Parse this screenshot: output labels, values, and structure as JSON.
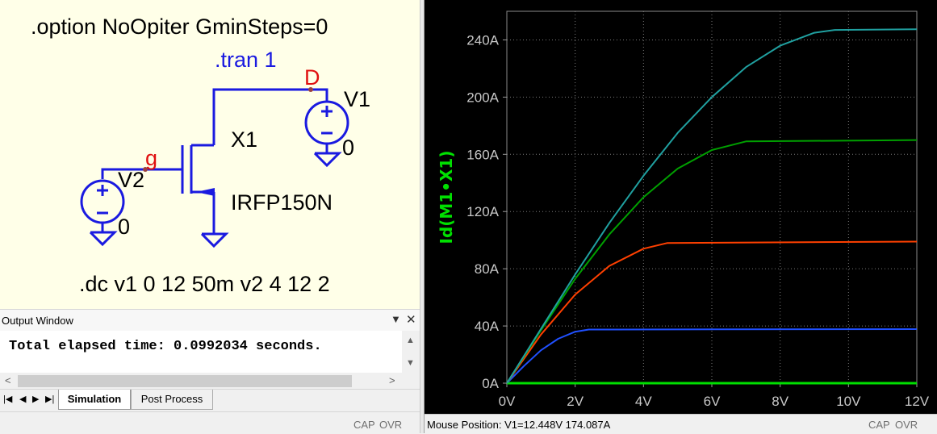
{
  "schematic": {
    "option_directive": ".option NoOpiter GminSteps=0",
    "tran_directive": ".tran 1",
    "dc_directive": ".dc v1 0 12 50m v2 4 12 2",
    "net_drain": "D",
    "net_gate": "g",
    "v1_name": "V1",
    "v1_value": "0",
    "v2_name": "V2",
    "v2_value": "0",
    "mosfet_name": "X1",
    "mosfet_model": "IRFP150N"
  },
  "output_window": {
    "title": "Output Window",
    "message": "Total elapsed time: 0.0992034 seconds.",
    "tabs": [
      "Simulation",
      "Post Process"
    ],
    "status": [
      "CAP",
      "OVR"
    ]
  },
  "plot": {
    "status_text": "Mouse Position: V1=12.448V  174.087A",
    "status": [
      "CAP",
      "OVR"
    ]
  },
  "chart_data": {
    "type": "line",
    "ylabel": "Id(M1•X1)",
    "xlabel": "",
    "xlim": [
      0,
      12
    ],
    "ylim": [
      0,
      260
    ],
    "x_ticks": [
      "0V",
      "2V",
      "4V",
      "6V",
      "8V",
      "10V",
      "12V"
    ],
    "y_ticks": [
      "0A",
      "40A",
      "80A",
      "120A",
      "160A",
      "200A",
      "240A"
    ],
    "grid": true,
    "series": [
      {
        "color": "#00e000",
        "points": [
          [
            0,
            0
          ],
          [
            12,
            0
          ]
        ]
      },
      {
        "color": "#2050ff",
        "points": [
          [
            0,
            0
          ],
          [
            0.5,
            12
          ],
          [
            1,
            23
          ],
          [
            1.5,
            31
          ],
          [
            2,
            36
          ],
          [
            2.4,
            37.5
          ],
          [
            12,
            37.8
          ]
        ]
      },
      {
        "color": "#ff4000",
        "points": [
          [
            0,
            0
          ],
          [
            1,
            34
          ],
          [
            2,
            62
          ],
          [
            3,
            82
          ],
          [
            4,
            94
          ],
          [
            4.7,
            98
          ],
          [
            12,
            99
          ]
        ]
      },
      {
        "color": "#00a000",
        "points": [
          [
            0,
            0
          ],
          [
            1,
            37
          ],
          [
            2,
            73
          ],
          [
            3,
            104
          ],
          [
            4,
            130
          ],
          [
            5,
            150
          ],
          [
            6,
            163
          ],
          [
            7,
            169
          ],
          [
            12,
            170
          ]
        ]
      },
      {
        "color": "#20a0a0",
        "points": [
          [
            0,
            0
          ],
          [
            1,
            38
          ],
          [
            2,
            76
          ],
          [
            3,
            112
          ],
          [
            4,
            145
          ],
          [
            5,
            175
          ],
          [
            6,
            200
          ],
          [
            7,
            221
          ],
          [
            8,
            236
          ],
          [
            9,
            245
          ],
          [
            9.6,
            247
          ],
          [
            12,
            247.5
          ]
        ]
      }
    ]
  }
}
